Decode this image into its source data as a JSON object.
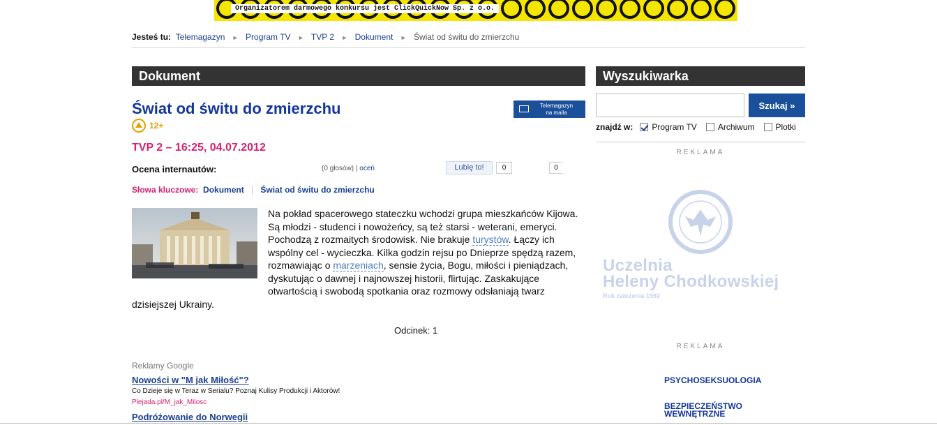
{
  "banner": {
    "text": "Organizatorem darmowego konkursu jest ClickQuickNow Sp. z o.o."
  },
  "breadcrumb": {
    "lead": "Jesteś tu:",
    "items": [
      "Telemagazyn",
      "Program TV",
      "TVP 2",
      "Dokument"
    ],
    "current": "Świat od świtu do zmierzchu"
  },
  "main": {
    "section_title": "Dokument",
    "title": "Świat od świtu do zmierzchu",
    "newsletter": {
      "line1": "Telemagazyn",
      "line2": "na maila"
    },
    "age_rating": "12+",
    "airing": "TVP 2 – 16:25, 04.07.2012",
    "rating": {
      "label": "Ocena internautów:",
      "votes": "(0 głosów) |",
      "rate_link": "oceń"
    },
    "facebook": {
      "like_label": "Lubię to!",
      "like_count": "0",
      "share_count": "0"
    },
    "keywords": {
      "label": "Słowa kluczowe:",
      "items": [
        "Dokument",
        "Świat od świtu do zmierzchu"
      ]
    },
    "description": {
      "part1": "Na pokład spacerowego stateczku wchodzi grupa mieszkańców Kijowa. Są młodzi - studenci i nowożeńcy, są też starsi - weterani, emeryci. Pochodzą z rozmaitych środowisk. Nie brakuje ",
      "link1": "turystów",
      "part2": ". Łączy ich wspólny cel - wycieczka. Kilka godzin rejsu po Dnieprze spędzą razem, rozmawiając o ",
      "link2": "marzeniach",
      "part3": ", sensie życia, Bogu, miłości i pieniądzach, dyskutując o dawnej i najnowszej historii, flirtując. Zaskakujące otwartością i swobodą spotkania oraz rozmowy odsłaniają twarz dzisiejszej Ukrainy."
    },
    "episode": "Odcinek: 1",
    "ads": {
      "heading": "Reklamy Google",
      "items": [
        {
          "title": "Nowości w \"M jak Miłość\"?",
          "text": "Co Dzieje się w Teraz w Serialu? Poznaj Kulisy Produkcji i Aktorów!",
          "url": "Plejada.pl/M_jak_Milosc"
        },
        {
          "title": "Podróżowanie do Norwegii"
        }
      ]
    }
  },
  "sidebar": {
    "section_title": "Wyszukiwarka",
    "search": {
      "value": "",
      "placeholder": "",
      "button": "Szukaj »"
    },
    "filters": {
      "label": "znajdź w:",
      "options": [
        {
          "label": "Program TV",
          "checked": true
        },
        {
          "label": "Archiwum",
          "checked": false
        },
        {
          "label": "Plotki",
          "checked": false
        }
      ]
    },
    "ad_label": "REKLAMA",
    "uhc": {
      "line1": "Uczelnia",
      "line2": "Heleny Chodkowskiej",
      "year": "Rok założenia 1992"
    },
    "ad_label2": "REKLAMA",
    "ad_link1": "PSYCHOSEKSUOLOGIA",
    "ad_link2_line1": "BEZPIECZEŃSTWO",
    "ad_link2_line2": "WEWNĘTRZNE"
  },
  "colors": {
    "dark_bar": "#333333",
    "brand_blue": "#1a4f9a",
    "link": "#1a3e92",
    "accent_pink": "#d6216f",
    "age_orange": "#e1a100"
  }
}
